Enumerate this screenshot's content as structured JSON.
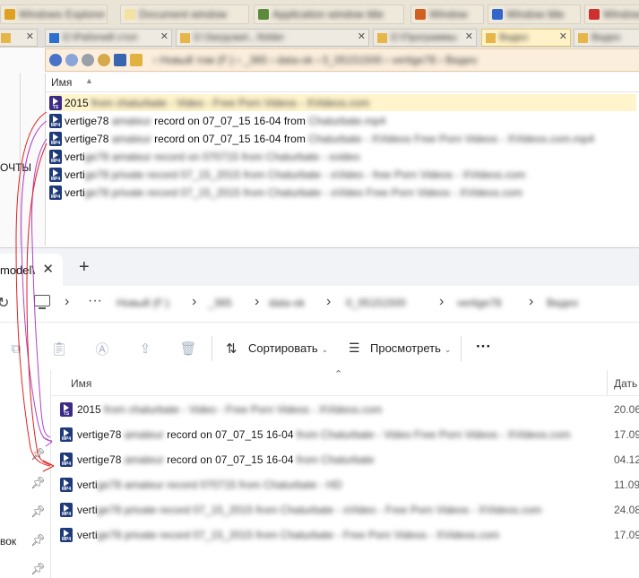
{
  "top_window": {
    "column_name": "Имя",
    "left_fragment": "ОЧТЫ",
    "rows": [
      {
        "type": "TS",
        "clear": "2015",
        "blur": " from chaturbate - Video - Free Porn Videos - XVideos.com"
      },
      {
        "type": "MP4",
        "clear": "vertige78 ",
        "blur": "amateur",
        "clear2": " record on 07_07_15 16-04 from ",
        "blur2": "Chaturbate.mp4"
      },
      {
        "type": "MP4",
        "clear": "vertige78 ",
        "blur": "amateur",
        "clear2": " record on 07_07_15 16-04 from ",
        "blur2": "Chaturbate - XVideos Free Porn Videos - XVideos.com.mp4"
      },
      {
        "type": "MP4",
        "clear": "verti",
        "blur": "ge78 amateur record on 070715 from Chaturbate - xvideo"
      },
      {
        "type": "MP4",
        "clear": "verti",
        "blur": "ge78 private record 07_15_2015 from Chaturbate - xVideo - free Porn Videos - XVideos.com"
      },
      {
        "type": "MP4",
        "clear": "verti",
        "blur": "ge78 private record 07_15_2015 from Chaturbate - xVideo Free Porn Videos - XVideos.com"
      }
    ]
  },
  "bottom_window": {
    "tab_title": "model\\",
    "breadcrumb": [
      "Новый (F:)",
      "_365",
      "data-ok",
      "0_05151500",
      "vertige78",
      "Видео"
    ],
    "toolbar": {
      "sort_label": "Сортировать",
      "view_label": "Просмотреть",
      "more_label": "···"
    },
    "column_name": "Имя",
    "column_date": "Дать",
    "sidebar_fragment": "вок",
    "rows": [
      {
        "type": "TS",
        "clear": "2015",
        "blur": " from chaturbate - Video - Free Porn Videos - XVideos.com",
        "date": "20.06"
      },
      {
        "type": "MP4",
        "clear": "vertige78 ",
        "blur": "amateur",
        "clear2": " record on 07_07_15 16-04",
        "blur2": " from Chaturbate - Video Free Porn Videos - XVideos.com",
        "date": "17.09"
      },
      {
        "type": "MP4",
        "clear": "vertige78 ",
        "blur": "amateur",
        "clear2": " record on 07_07_15 16-04",
        "blur2": " from Chaturbate",
        "date": "04.12"
      },
      {
        "type": "MP4",
        "clear": "verti",
        "blur": "ge78 amateur record 070715 from Chaturbate - HD",
        "date": "11.09"
      },
      {
        "type": "MP4",
        "clear": "verti",
        "blur": "ge78 private record 07_15_2015 from Chaturbate - xVideo - Free Porn Videos - XVideos.com",
        "date": "24.08"
      },
      {
        "type": "MP4",
        "clear": "verti",
        "blur": "ge78 private record 07_15_2015 from Chaturbate - Free Porn Videos - XVideos.com",
        "date": "17.09"
      }
    ]
  }
}
